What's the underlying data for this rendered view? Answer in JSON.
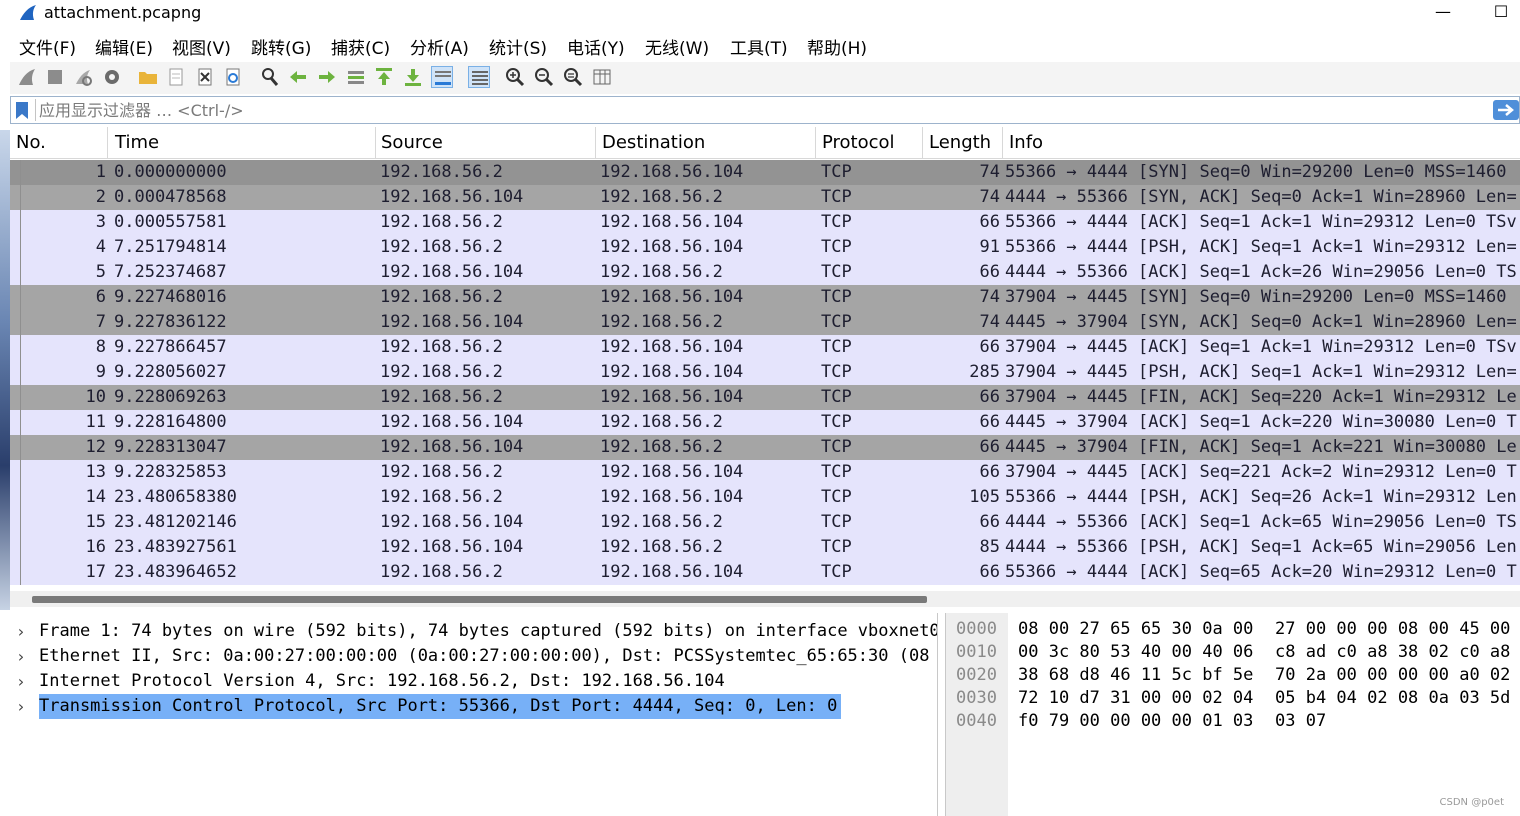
{
  "window": {
    "title": "attachment.pcapng",
    "minimize_glyph": "—",
    "maximize_glyph": "☐"
  },
  "menu": {
    "items": [
      "文件(F)",
      "编辑(E)",
      "视图(V)",
      "跳转(G)",
      "捕获(C)",
      "分析(A)",
      "统计(S)",
      "电话(Y)",
      "无线(W)",
      "工具(T)",
      "帮助(H)"
    ]
  },
  "toolbar": {
    "icons": [
      "shark-start-icon",
      "stop-icon",
      "restart-icon",
      "options-gear-icon",
      "open-folder-icon",
      "save-file-icon",
      "close-file-icon",
      "reload-icon",
      "find-icon",
      "back-arrow-icon",
      "forward-arrow-icon",
      "goto-packet-icon",
      "first-packet-icon",
      "last-packet-icon",
      "autoscroll-icon",
      "colorize-icon",
      "zoom-in-icon",
      "zoom-out-icon",
      "zoom-reset-icon",
      "resize-columns-icon"
    ],
    "active_icons": [
      "autoscroll-icon",
      "colorize-icon"
    ]
  },
  "filter": {
    "placeholder": "应用显示过滤器 … <Ctrl-/>",
    "value": ""
  },
  "packet_list": {
    "columns": [
      "No.",
      "Time",
      "Source",
      "Destination",
      "Protocol",
      "Length",
      "Info"
    ],
    "rows": [
      {
        "no": "1",
        "time": "0.000000000",
        "src": "192.168.56.2",
        "dst": "192.168.56.104",
        "proto": "TCP",
        "len": "74",
        "info": "55366 → 4444 [SYN] Seq=0 Win=29200 Len=0 MSS=1460",
        "style": "sel"
      },
      {
        "no": "2",
        "time": "0.000478568",
        "src": "192.168.56.104",
        "dst": "192.168.56.2",
        "proto": "TCP",
        "len": "74",
        "info": "4444 → 55366 [SYN, ACK] Seq=0 Ack=1 Win=28960 Len=",
        "style": "dark"
      },
      {
        "no": "3",
        "time": "0.000557581",
        "src": "192.168.56.2",
        "dst": "192.168.56.104",
        "proto": "TCP",
        "len": "66",
        "info": "55366 → 4444 [ACK] Seq=1 Ack=1 Win=29312 Len=0 TSv",
        "style": "light"
      },
      {
        "no": "4",
        "time": "7.251794814",
        "src": "192.168.56.2",
        "dst": "192.168.56.104",
        "proto": "TCP",
        "len": "91",
        "info": "55366 → 4444 [PSH, ACK] Seq=1 Ack=1 Win=29312 Len=",
        "style": "light"
      },
      {
        "no": "5",
        "time": "7.252374687",
        "src": "192.168.56.104",
        "dst": "192.168.56.2",
        "proto": "TCP",
        "len": "66",
        "info": "4444 → 55366 [ACK] Seq=1 Ack=26 Win=29056 Len=0 TS",
        "style": "light"
      },
      {
        "no": "6",
        "time": "9.227468016",
        "src": "192.168.56.2",
        "dst": "192.168.56.104",
        "proto": "TCP",
        "len": "74",
        "info": "37904 → 4445 [SYN] Seq=0 Win=29200 Len=0 MSS=1460",
        "style": "dark"
      },
      {
        "no": "7",
        "time": "9.227836122",
        "src": "192.168.56.104",
        "dst": "192.168.56.2",
        "proto": "TCP",
        "len": "74",
        "info": "4445 → 37904 [SYN, ACK] Seq=0 Ack=1 Win=28960 Len=",
        "style": "dark"
      },
      {
        "no": "8",
        "time": "9.227866457",
        "src": "192.168.56.2",
        "dst": "192.168.56.104",
        "proto": "TCP",
        "len": "66",
        "info": "37904 → 4445 [ACK] Seq=1 Ack=1 Win=29312 Len=0 TSv",
        "style": "light"
      },
      {
        "no": "9",
        "time": "9.228056027",
        "src": "192.168.56.2",
        "dst": "192.168.56.104",
        "proto": "TCP",
        "len": "285",
        "info": "37904 → 4445 [PSH, ACK] Seq=1 Ack=1 Win=29312 Len=",
        "style": "light"
      },
      {
        "no": "10",
        "time": "9.228069263",
        "src": "192.168.56.2",
        "dst": "192.168.56.104",
        "proto": "TCP",
        "len": "66",
        "info": "37904 → 4445 [FIN, ACK] Seq=220 Ack=1 Win=29312 Le",
        "style": "dark"
      },
      {
        "no": "11",
        "time": "9.228164800",
        "src": "192.168.56.104",
        "dst": "192.168.56.2",
        "proto": "TCP",
        "len": "66",
        "info": "4445 → 37904 [ACK] Seq=1 Ack=220 Win=30080 Len=0 T",
        "style": "light"
      },
      {
        "no": "12",
        "time": "9.228313047",
        "src": "192.168.56.104",
        "dst": "192.168.56.2",
        "proto": "TCP",
        "len": "66",
        "info": "4445 → 37904 [FIN, ACK] Seq=1 Ack=221 Win=30080 Le",
        "style": "dark"
      },
      {
        "no": "13",
        "time": "9.228325853",
        "src": "192.168.56.2",
        "dst": "192.168.56.104",
        "proto": "TCP",
        "len": "66",
        "info": "37904 → 4445 [ACK] Seq=221 Ack=2 Win=29312 Len=0 T",
        "style": "light"
      },
      {
        "no": "14",
        "time": "23.480658380",
        "src": "192.168.56.2",
        "dst": "192.168.56.104",
        "proto": "TCP",
        "len": "105",
        "info": "55366 → 4444 [PSH, ACK] Seq=26 Ack=1 Win=29312 Len",
        "style": "light"
      },
      {
        "no": "15",
        "time": "23.481202146",
        "src": "192.168.56.104",
        "dst": "192.168.56.2",
        "proto": "TCP",
        "len": "66",
        "info": "4444 → 55366 [ACK] Seq=1 Ack=65 Win=29056 Len=0 TS",
        "style": "light"
      },
      {
        "no": "16",
        "time": "23.483927561",
        "src": "192.168.56.104",
        "dst": "192.168.56.2",
        "proto": "TCP",
        "len": "85",
        "info": "4444 → 55366 [PSH, ACK] Seq=1 Ack=65 Win=29056 Len",
        "style": "light"
      },
      {
        "no": "17",
        "time": "23.483964652",
        "src": "192.168.56.2",
        "dst": "192.168.56.104",
        "proto": "TCP",
        "len": "66",
        "info": "55366 → 4444 [ACK] Seq=65 Ack=20 Win=29312 Len=0 T",
        "style": "light"
      }
    ]
  },
  "details": {
    "items": [
      {
        "label": "Frame 1: 74 bytes on wire (592 bits), 74 bytes captured (592 bits) on interface vboxnet0",
        "selected": false
      },
      {
        "label": "Ethernet II, Src: 0a:00:27:00:00:00 (0a:00:27:00:00:00), Dst: PCSSystemtec_65:65:30 (08",
        "selected": false
      },
      {
        "label": "Internet Protocol Version 4, Src: 192.168.56.2, Dst: 192.168.56.104",
        "selected": false
      },
      {
        "label": "Transmission Control Protocol, Src Port: 55366, Dst Port: 4444, Seq: 0, Len: 0",
        "selected": true
      }
    ],
    "expander_glyph": "›"
  },
  "bytes": {
    "rows": [
      {
        "offset": "0000",
        "a": "08 00 27 65 65 30 0a 00",
        "b": "27 00 00 00 08 00 45 00"
      },
      {
        "offset": "0010",
        "a": "00 3c 80 53 40 00 40 06",
        "b": "c8 ad c0 a8 38 02 c0 a8"
      },
      {
        "offset": "0020",
        "a": "38 68 d8 46 11 5c bf 5e",
        "b": "70 2a 00 00 00 00 a0 02"
      },
      {
        "offset": "0030",
        "a": "72 10 d7 31 00 00 02 04",
        "b": "05 b4 04 02 08 0a 03 5d"
      },
      {
        "offset": "0040",
        "a": "f0 79 00 00 00 00 01 03",
        "b": "03 07"
      }
    ]
  },
  "watermark": "CSDN @p0et",
  "colors": {
    "row_light": "#e5e4fc",
    "row_dark": "#a5a5a5",
    "row_selected": "#939393",
    "detail_highlight": "#77b0f7",
    "accent": "#4f8fd9"
  }
}
